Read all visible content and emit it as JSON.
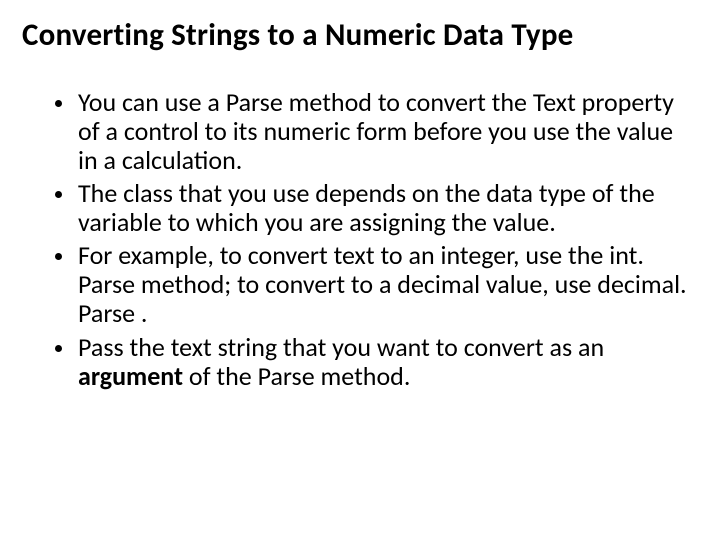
{
  "title": "Converting Strings to a Numeric Data Type",
  "bullets": [
    "You can use a Parse method to convert the Text property of a control to its numeric form before you use the value in a calculation.",
    "The class that you use depends on the data type of the variable to which you are assigning the value.",
    "For example, to convert text to an integer, use the int. Parse method; to convert to a decimal value, use decimal. Parse .",
    "Pass the text string that you want to convert as an <b>argument</b> of the Parse method."
  ]
}
